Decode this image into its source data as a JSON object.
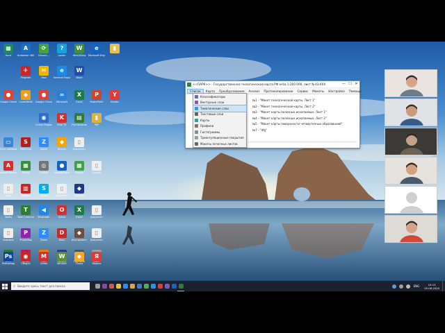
{
  "desktop": {
    "icons": [
      {
        "label": "Ноrtr",
        "color": "#1d8a5c",
        "glyph": "▦",
        "col": 0,
        "row": 0
      },
      {
        "label": "Autodesk 360",
        "color": "#1b6fc1",
        "glyph": "A",
        "col": 1,
        "row": 0
      },
      {
        "label": "Ciscom...",
        "color": "#45a33e",
        "glyph": "⟳",
        "col": 2,
        "row": 0
      },
      {
        "label": "Lorem",
        "color": "#1aa0d8",
        "glyph": "?",
        "col": 3,
        "row": 0
      },
      {
        "label": "WinDjView",
        "color": "#3f8f3a",
        "glyph": "W",
        "col": 4,
        "row": 0
      },
      {
        "label": "Microsoft Edge",
        "color": "#1565c0",
        "glyph": "e",
        "col": 5,
        "row": 0
      },
      {
        "label": "",
        "color": "#e8c050",
        "glyph": "▮",
        "col": 6,
        "row": 0
      },
      {
        "label": "Program",
        "color": "#c62828",
        "glyph": "✈",
        "col": 1,
        "row": 1
      },
      {
        "label": "Mail",
        "color": "#f5b400",
        "glyph": "✉",
        "col": 2,
        "row": 1
      },
      {
        "label": "Internet Explorer",
        "color": "#1e88e5",
        "glyph": "e",
        "col": 3,
        "row": 1
      },
      {
        "label": "Word",
        "color": "#1e4fa8",
        "glyph": "W",
        "col": 4,
        "row": 1
      },
      {
        "label": "Google Chrome",
        "color": "#db4437",
        "glyph": "●",
        "col": 0,
        "row": 2
      },
      {
        "label": "CorelDRAW",
        "color": "#f29d1a",
        "glyph": "◆",
        "col": 1,
        "row": 2
      },
      {
        "label": "Google Chrome",
        "color": "#db4437",
        "glyph": "●",
        "col": 2,
        "row": 2
      },
      {
        "label": "Microsoft",
        "color": "#2b7fd6",
        "glyph": "∞",
        "col": 3,
        "row": 2
      },
      {
        "label": "Excel",
        "color": "#1e7a45",
        "glyph": "X",
        "col": 4,
        "row": 2
      },
      {
        "label": "PowerPoint",
        "color": "#c9472b",
        "glyph": "P",
        "col": 5,
        "row": 2
      },
      {
        "label": "Yandex",
        "color": "#e53935",
        "glyph": "Y",
        "col": 6,
        "row": 2
      },
      {
        "label": "Стань Яндекс",
        "color": "#2f6fc9",
        "glyph": "◉",
        "col": 2,
        "row": 3
      },
      {
        "label": "Kino TV",
        "color": "#d32f2f",
        "glyph": "K",
        "col": 3,
        "row": 3
      },
      {
        "label": "Расписание",
        "color": "#2e7d32",
        "glyph": "▤",
        "col": 4,
        "row": 3
      },
      {
        "label": "PDF",
        "color": "#e0b23c",
        "glyph": "▮",
        "col": 5,
        "row": 3
      },
      {
        "label": "Этот компьютер",
        "color": "#3a86d4",
        "glyph": "▭",
        "col": 0,
        "row": 4
      },
      {
        "label": "Sketchup",
        "color": "#b71c1c",
        "glyph": "S",
        "col": 1,
        "row": 4
      },
      {
        "label": "Zoom",
        "color": "#2d8cff",
        "glyph": "Z",
        "col": 2,
        "row": 4
      },
      {
        "label": "Bitcoin",
        "color": "#f7a600",
        "glyph": "◆",
        "col": 3,
        "row": 4
      },
      {
        "label": "Документ",
        "color": "#eeeeee",
        "glyph": "▯",
        "col": 4,
        "row": 4
      },
      {
        "label": "Adobe Reader",
        "color": "#d32f2f",
        "glyph": "A",
        "col": 0,
        "row": 5
      },
      {
        "label": "Карта",
        "color": "#388e3c",
        "glyph": "▦",
        "col": 1,
        "row": 5
      },
      {
        "label": "Vivaldi",
        "color": "#757575",
        "glyph": "◎",
        "col": 2,
        "row": 5
      },
      {
        "label": "Google Earth",
        "color": "#1565c0",
        "glyph": "●",
        "col": 3,
        "row": 5
      },
      {
        "label": "Карты",
        "color": "#43a047",
        "glyph": "▦",
        "col": 4,
        "row": 5
      },
      {
        "label": "Шрифт",
        "color": "#eeeeee",
        "glyph": "▯",
        "col": 5,
        "row": 5
      },
      {
        "label": "Docs",
        "color": "#eeeeee",
        "glyph": "▯",
        "col": 0,
        "row": 6
      },
      {
        "label": "Reader",
        "color": "#c62828",
        "glyph": "▥",
        "col": 1,
        "row": 6
      },
      {
        "label": "Skype",
        "color": "#00aff0",
        "glyph": "S",
        "col": 2,
        "row": 6
      },
      {
        "label": "Документ",
        "color": "#eeeeee",
        "glyph": "▯",
        "col": 3,
        "row": 6
      },
      {
        "label": "Проекты",
        "color": "#1e3a8a",
        "glyph": "◆",
        "col": 4,
        "row": 6
      },
      {
        "label": "Файл",
        "color": "#eeeeee",
        "glyph": "▯",
        "col": 0,
        "row": 7
      },
      {
        "label": "Total Commander",
        "color": "#2e7d32",
        "glyph": "T",
        "col": 1,
        "row": 7
      },
      {
        "label": "Bluetooth",
        "color": "#1e88e5",
        "glyph": "◀",
        "col": 2,
        "row": 7
      },
      {
        "label": "Opera",
        "color": "#d32f2f",
        "glyph": "O",
        "col": 3,
        "row": 7
      },
      {
        "label": "Excel",
        "color": "#1e7a45",
        "glyph": "X",
        "col": 4,
        "row": 7
      },
      {
        "label": "Документ",
        "color": "#eeeeee",
        "glyph": "▯",
        "col": 5,
        "row": 7
      },
      {
        "label": "Корзина",
        "color": "#eeeeee",
        "glyph": "▯",
        "col": 0,
        "row": 8
      },
      {
        "label": "PhotoMag",
        "color": "#8e24aa",
        "glyph": "P",
        "col": 1,
        "row": 8
      },
      {
        "label": "Zoom",
        "color": "#2d8cff",
        "glyph": "Z",
        "col": 2,
        "row": 8
      },
      {
        "label": "Docs",
        "color": "#c62828",
        "glyph": "D",
        "col": 3,
        "row": 8
      },
      {
        "label": "Инструмент",
        "color": "#6d4c41",
        "glyph": "◆",
        "col": 4,
        "row": 8
      },
      {
        "label": "Документ",
        "color": "#eeeeee",
        "glyph": "▯",
        "col": 5,
        "row": 8
      },
      {
        "label": "Файл",
        "color": "#2e7d32",
        "glyph": "◉",
        "col": 0,
        "row": 9
      },
      {
        "label": "Визор",
        "color": "#c2185b",
        "glyph": "◉",
        "col": 1,
        "row": 9
      },
      {
        "label": "Sun",
        "color": "#f57c00",
        "glyph": "☀",
        "col": 2,
        "row": 9
      },
      {
        "label": "Проект",
        "color": "#2e3c8a",
        "glyph": "▦",
        "col": 3,
        "row": 9
      },
      {
        "label": "Паутина",
        "color": "#455a64",
        "glyph": "◆",
        "col": 4,
        "row": 9
      },
      {
        "label": "Сайт",
        "color": "#9e9e9e",
        "glyph": "▯",
        "col": 5,
        "row": 9
      },
      {
        "label": "Photoshop",
        "color": "#0d47a1",
        "glyph": "Ps",
        "col": 0,
        "row": 10
      },
      {
        "label": "Сборка",
        "color": "#c62828",
        "glyph": "◉",
        "col": 1,
        "row": 10
      },
      {
        "label": "Gmail",
        "color": "#d32f2f",
        "glyph": "M",
        "col": 2,
        "row": 10
      },
      {
        "label": "WinRAR",
        "color": "#5d8f3a",
        "glyph": "W",
        "col": 3,
        "row": 10
      },
      {
        "label": "Точка",
        "color": "#f9a825",
        "glyph": "◆",
        "col": 4,
        "row": 10
      },
      {
        "label": "Яндекс",
        "color": "#e53935",
        "glyph": "Я",
        "col": 5,
        "row": 10
      }
    ]
  },
  "window": {
    "title": "<<ПАРК>> - Государственная геологическая карта РФ м-ба 1:200 000, лист N-43-XXX",
    "controls": {
      "minimize": "—",
      "maximize": "☐",
      "close": "✕"
    },
    "menu": {
      "items": [
        "Список",
        "Карта",
        "Преобразования",
        "Анализ",
        "Протоколирование",
        "Сервис",
        "Макеты"
      ],
      "active_index": 0,
      "right_items": [
        "Настройка",
        "Помощь"
      ]
    },
    "dropdown": {
      "items": [
        {
          "label": "Классификаторы",
          "color": "#5c6bc0"
        },
        {
          "label": "Векторные слои",
          "color": "#7e57c2"
        },
        {
          "label": "Тематические слои",
          "color": "#4a90d9"
        },
        {
          "label": "Текстовые слои",
          "color": "#616161"
        },
        {
          "label": "Карты",
          "color": "#26a69a"
        },
        {
          "label": "Профили",
          "color": "#8d6e63"
        },
        {
          "label": "Гистограммы",
          "color": "#78909c"
        },
        {
          "label": "Триангуляционные покрытия",
          "color": "#9e9e9e"
        },
        {
          "label": "Макеты печатных листов",
          "color": "#546e7a"
        }
      ],
      "highlighted_index": 2
    },
    "sheets": [
      "№1 - \"Макет геологической карты. Лист 1\"",
      "№2 - \"Макет геологической карты. Лист 2\"",
      "№3 - \"Макет карты полезных ископаемых. Лист 1\"",
      "№4 - \"Макет карты полезных ископаемых. Лист 2\"",
      "№5 - \"Макет карты поверхности четвертичных образований\"",
      "№7 - \"dfg\""
    ]
  },
  "participants": [
    {
      "bg": "#e9e4df",
      "skin": "#d9a58a",
      "shirt": "#6d7b8a"
    },
    {
      "bg": "#dfe3e8",
      "skin": "#c99a7c",
      "shirt": "#3a5a8a"
    },
    {
      "bg": "#3c3a36",
      "skin": "#c2a38a",
      "shirt": "#6b6157"
    },
    {
      "bg": "#e6e2de",
      "skin": "#d2a283",
      "shirt": "#4a5a6a"
    },
    {
      "bg": "#ffffff",
      "skin": "#cfcfcf",
      "shirt": "#cfcfcf",
      "placeholder": true
    },
    {
      "bg": "#dedad5",
      "skin": "#d4a48a",
      "shirt": "#d04a3a"
    }
  ],
  "taskbar": {
    "search_placeholder": "Введите здесь текст для поиска",
    "apps": [
      {
        "color": "#9e9e9e"
      },
      {
        "color": "#8e44ad"
      },
      {
        "color": "#d9534f"
      },
      {
        "color": "#f0c419"
      },
      {
        "color": "#2d8cff"
      },
      {
        "color": "#e8a33c"
      },
      {
        "color": "#3a7bd5"
      },
      {
        "color": "#4caf50"
      },
      {
        "color": "#2196f3"
      },
      {
        "color": "#e53935"
      },
      {
        "color": "#7e57c2"
      },
      {
        "color": "#1565c0"
      },
      {
        "color": "#2e7d32",
        "active": true
      }
    ],
    "language": "ENG",
    "time": "15:13",
    "date": "05.06.2020"
  }
}
